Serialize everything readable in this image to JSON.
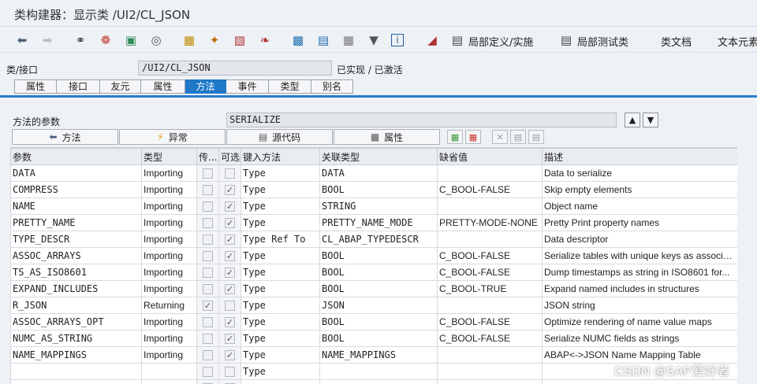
{
  "window": {
    "title": "类构建器：显示类 /UI2/CL_JSON"
  },
  "toolbar": {
    "icons": [
      "back-arrow-icon",
      "forward-arrow-icon",
      "glasses-icon",
      "object-list-icon",
      "where-used-icon",
      "display-object-icon",
      "hierarchy-icon",
      "magic-wand-icon",
      "pattern-icon",
      "navigation-icon",
      "tree-icon",
      "tree-alt-icon",
      "layout-icon",
      "filter-icon",
      "info-icon",
      "cube-icon"
    ],
    "local_def": "局部定义/实施",
    "local_test": "局部测试类",
    "class_doc": "类文档",
    "text_elements": "文本元素"
  },
  "class_line": {
    "label": "类/接口",
    "value": "/UI2/CL_JSON",
    "status": "已实现 / 已激活"
  },
  "tabs": [
    "属性",
    "接口",
    "友元",
    "属性",
    "方法",
    "事件",
    "类型",
    "别名"
  ],
  "active_tab": "方法",
  "method_line": {
    "label": "方法的参数",
    "value": "SERIALIZE"
  },
  "subbuttons": {
    "methods": "方法",
    "exceptions": "异常",
    "source": "源代码",
    "attributes": "属性"
  },
  "grid": {
    "headers": [
      "参数",
      "类型",
      "传...",
      "可选",
      "键入方法",
      "关联类型",
      "缺省值",
      "描述"
    ],
    "rows": [
      {
        "param": "DATA",
        "type": "Importing",
        "pass": false,
        "opt": false,
        "typing": "Type",
        "assoc": "DATA",
        "default": "",
        "desc": "Data to serialize"
      },
      {
        "param": "COMPRESS",
        "type": "Importing",
        "pass": false,
        "opt": true,
        "typing": "Type",
        "assoc": "BOOL",
        "default": "C_BOOL-FALSE",
        "desc": "Skip empty elements"
      },
      {
        "param": "NAME",
        "type": "Importing",
        "pass": false,
        "opt": true,
        "typing": "Type",
        "assoc": "STRING",
        "default": "",
        "desc": "Object name"
      },
      {
        "param": "PRETTY_NAME",
        "type": "Importing",
        "pass": false,
        "opt": true,
        "typing": "Type",
        "assoc": "PRETTY_NAME_MODE",
        "default": "PRETTY-MODE-NONE",
        "desc": "Pretty Print property names"
      },
      {
        "param": "TYPE_DESCR",
        "type": "Importing",
        "pass": false,
        "opt": true,
        "typing": "Type Ref To",
        "assoc": "CL_ABAP_TYPEDESCR",
        "default": "",
        "desc": "Data descriptor"
      },
      {
        "param": "ASSOC_ARRAYS",
        "type": "Importing",
        "pass": false,
        "opt": true,
        "typing": "Type",
        "assoc": "BOOL",
        "default": "C_BOOL-FALSE",
        "desc": "Serialize tables with unique keys as associati..."
      },
      {
        "param": "TS_AS_ISO8601",
        "type": "Importing",
        "pass": false,
        "opt": true,
        "typing": "Type",
        "assoc": "BOOL",
        "default": "C_BOOL-FALSE",
        "desc": "Dump timestamps as string in ISO8601 for..."
      },
      {
        "param": "EXPAND_INCLUDES",
        "type": "Importing",
        "pass": false,
        "opt": true,
        "typing": "Type",
        "assoc": "BOOL",
        "default": "C_BOOL-TRUE",
        "desc": "Expand named includes in structures"
      },
      {
        "param": "R_JSON",
        "type": "Returning",
        "pass": true,
        "opt": false,
        "typing": "Type",
        "assoc": "JSON",
        "default": "",
        "desc": "JSON string"
      },
      {
        "param": "ASSOC_ARRAYS_OPT",
        "type": "Importing",
        "pass": false,
        "opt": true,
        "typing": "Type",
        "assoc": "BOOL",
        "default": "C_BOOL-FALSE",
        "desc": "Optimize rendering of name value maps"
      },
      {
        "param": "NUMC_AS_STRING",
        "type": "Importing",
        "pass": false,
        "opt": true,
        "typing": "Type",
        "assoc": "BOOL",
        "default": "C_BOOL-FALSE",
        "desc": "Serialize NUMC fields as strings"
      },
      {
        "param": "NAME_MAPPINGS",
        "type": "Importing",
        "pass": false,
        "opt": true,
        "typing": "Type",
        "assoc": "NAME_MAPPINGS",
        "default": "",
        "desc": "ABAP<->JSON Name Mapping Table"
      },
      {
        "param": "",
        "type": "",
        "pass": false,
        "opt": false,
        "typing": "Type",
        "assoc": "",
        "default": "",
        "desc": ""
      },
      {
        "param": "",
        "type": "",
        "pass": false,
        "opt": false,
        "typing": "Type",
        "assoc": "",
        "default": "",
        "desc": ""
      }
    ]
  },
  "watermark": "CSDN @SAP爱好者"
}
